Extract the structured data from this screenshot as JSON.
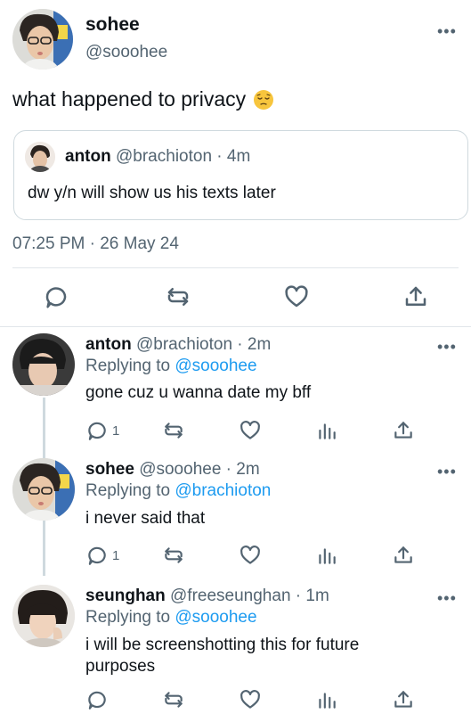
{
  "main_tweet": {
    "author_name": "sohee",
    "author_handle": "@sooohee",
    "text": "what happened to privacy",
    "emoji": "pensive-face",
    "quoted": {
      "author_name": "anton",
      "author_handle": "@brachioton · 4m",
      "text": "dw y/n will show us his texts later"
    },
    "timestamp": "07:25 PM · 26 May 24",
    "actions": [
      "reply-icon",
      "retweet-icon",
      "like-icon",
      "share-icon"
    ]
  },
  "replies": [
    {
      "author_name": "anton",
      "author_handle": "@brachioton · 2m",
      "replying_prefix": "Replying to",
      "replying_to": "@sooohee",
      "text": "gone cuz u wanna date my bff",
      "reply_count": "1"
    },
    {
      "author_name": "sohee",
      "author_handle": "@sooohee · 2m",
      "replying_prefix": "Replying to",
      "replying_to": "@brachioton",
      "text": "i never said that",
      "reply_count": "1"
    },
    {
      "author_name": "seunghan",
      "author_handle": "@freeseunghan · 1m",
      "replying_prefix": "Replying to",
      "replying_to": "@sooohee",
      "text": "i will be screenshotting this for future purposes",
      "reply_count": ""
    }
  ],
  "colors": {
    "text": "#0f1419",
    "secondary": "#536471",
    "link": "#1d9bf0",
    "border": "#cfd9de"
  }
}
